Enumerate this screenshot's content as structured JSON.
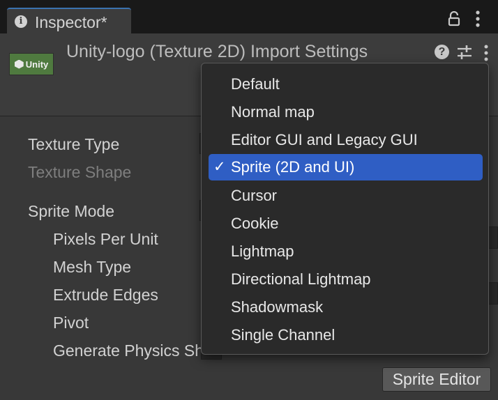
{
  "tab": {
    "title": "Inspector*",
    "info_icon": "i"
  },
  "header": {
    "logo_text": "Unity",
    "title": "Unity-logo (Texture 2D) Import Settings",
    "help_icon": "?"
  },
  "properties": {
    "texture_type": "Texture Type",
    "texture_shape": "Texture Shape",
    "sprite_mode": "Sprite Mode",
    "pixels_per_unit": "Pixels Per Unit",
    "mesh_type": "Mesh Type",
    "extrude_edges": "Extrude Edges",
    "pivot": "Pivot",
    "generate_physics": "Generate Physics Shape"
  },
  "buttons": {
    "sprite_editor": "Sprite Editor"
  },
  "dropdown": {
    "check_glyph": "✓",
    "items": [
      {
        "label": "Default"
      },
      {
        "label": "Normal map"
      },
      {
        "label": "Editor GUI and Legacy GUI"
      },
      {
        "label": "Sprite (2D and UI)",
        "selected": true
      },
      {
        "label": "Cursor"
      },
      {
        "label": "Cookie"
      },
      {
        "label": "Lightmap"
      },
      {
        "label": "Directional Lightmap"
      },
      {
        "label": "Shadowmask"
      },
      {
        "label": "Single Channel"
      }
    ]
  },
  "colors": {
    "selection": "#2f5ec4",
    "tab_accent": "#3a72b0",
    "logo_bg": "#4f7a3f"
  }
}
